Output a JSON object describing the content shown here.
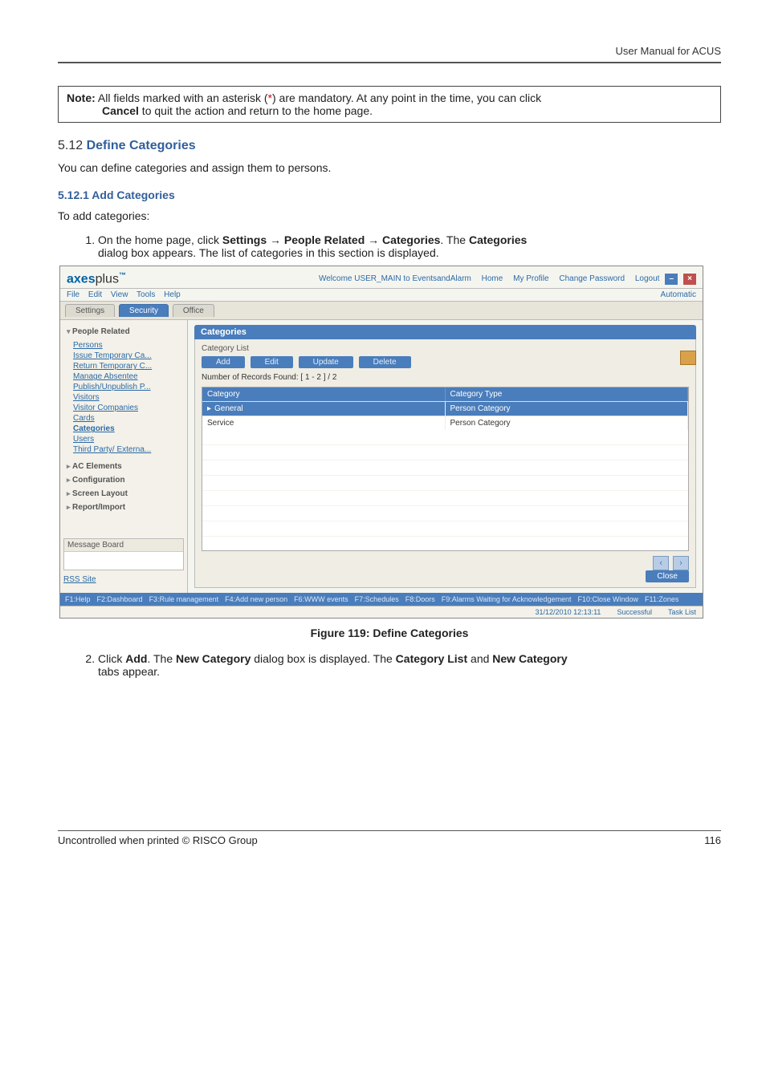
{
  "doc": {
    "header_right": "User Manual for ACUS",
    "note_prefix": "Note:",
    "note_line1": " All fields marked with an asterisk (",
    "note_star": "*",
    "note_line1b": ") are mandatory. At any point in the time, you can click",
    "note_line2": "Cancel",
    "note_line2b": " to quit the action and return to the home page.",
    "sec_num": "5.12 ",
    "sec_title": "Define Categories",
    "sec_intro": "You can define categories and assign them to persons.",
    "sub_num": "5.12.1  ",
    "sub_title": "Add Categories",
    "sub_intro": "To add categories:",
    "step1_a": "On the home page, click ",
    "step1_settings": "Settings",
    "step1_arrow": " → ",
    "step1_people": "People Related",
    "step1_cats": "Categories",
    "step1_b": ". The ",
    "step1_catsb": "Categories",
    "step1_c": " dialog box appears. The list of categories in this section is displayed.",
    "figure_caption": "Figure 119: Define Categories",
    "step2_a": "Click ",
    "step2_add": "Add",
    "step2_b": ". The ",
    "step2_new": "New Category",
    "step2_c": " dialog box is displayed. The ",
    "step2_list": "Category List",
    "step2_and": " and ",
    "step2_newcat": "New Category",
    "step2_d": " tabs appear.",
    "footer_left": "Uncontrolled when printed © RISCO Group",
    "footer_right": "116"
  },
  "app": {
    "logo_a": "axes",
    "logo_b": "plus",
    "logo_tm": "™",
    "welcome": "Welcome USER_MAIN to EventsandAlarm",
    "toplinks": [
      "Home",
      "My Profile",
      "Change Password",
      "Logout"
    ],
    "menus": [
      "File",
      "Edit",
      "View",
      "Tools",
      "Help"
    ],
    "menu_right": "Automatic",
    "tabs": [
      "Settings",
      "Security",
      "Office"
    ],
    "side_people": "People Related",
    "side_people_items": [
      "Persons",
      "Issue Temporary Ca...",
      "Return Temporary C...",
      "Manage Absentee",
      "Publish/Unpublish P...",
      "Visitors",
      "Visitor Companies",
      "Cards",
      "Categories",
      "Users",
      "Third Party/ Externa..."
    ],
    "side_ac": "AC Elements",
    "side_conf": "Configuration",
    "side_screen": "Screen Layout",
    "side_report": "Report/Import",
    "msg_board": "Message Board",
    "rss": "RSS Site",
    "panel_title": "Categories",
    "panel_sub": "Category List",
    "buttons": [
      "Add",
      "Edit",
      "Update",
      "Delete"
    ],
    "records": "Number of Records Found: [ 1 - 2 ] / 2",
    "grid_head": [
      "Category",
      "Category Type"
    ],
    "grid_rows": [
      {
        "c": "General",
        "t": "Person Category",
        "sel": true
      },
      {
        "c": "Service",
        "t": "Person Category",
        "sel": false
      }
    ],
    "close_btn": "Close",
    "fkeys": [
      "F1:Help",
      "F2:Dashboard",
      "F3:Rule management",
      "F4:Add new person",
      "F6:WWW events",
      "F7:Schedules",
      "F8:Doors",
      "F9:Alarms Waiting for Acknowledgement",
      "F10:Close Window",
      "F11:Zones"
    ],
    "status_time": "31/12/2010 12:13:11",
    "status_msg": "Successful",
    "status_task": "Task List"
  }
}
